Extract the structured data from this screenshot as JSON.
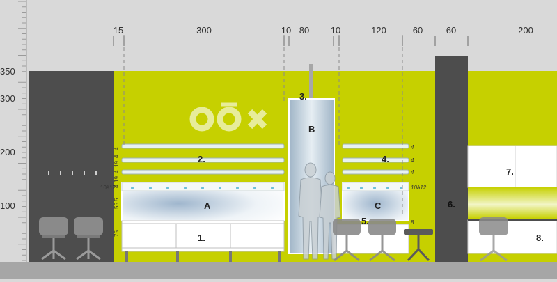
{
  "colors": {
    "background": "#d9d9d9",
    "wall": "#c6d000",
    "dark_panel": "#4d4d4d",
    "floor": "#a6a6a6",
    "shelf": "#e8f2f0",
    "glass": "#bcd0e0",
    "logo": "#e7ec9a"
  },
  "dimensions_top": [
    "15",
    "300",
    "10",
    "80",
    "10",
    "120",
    "60",
    "60",
    "200"
  ],
  "height_scale": [
    "350",
    "300",
    "200",
    "100"
  ],
  "vertical_dims": {
    "left": [
      "4",
      "4",
      "19",
      "4",
      "19",
      "4",
      "10à12",
      "55.5",
      "75"
    ],
    "right": [
      "4",
      "4",
      "4",
      "10à12",
      "8"
    ]
  },
  "labels": {
    "1": "1.",
    "2": "2.",
    "3": "3.",
    "4": "4.",
    "5": "5.",
    "6": "6.",
    "7": "7.",
    "8": "8.",
    "A": "A",
    "B": "B",
    "C": "C"
  },
  "icons": [
    "logo-mark",
    "human-silhouette",
    "office-chair",
    "bar-stool"
  ]
}
